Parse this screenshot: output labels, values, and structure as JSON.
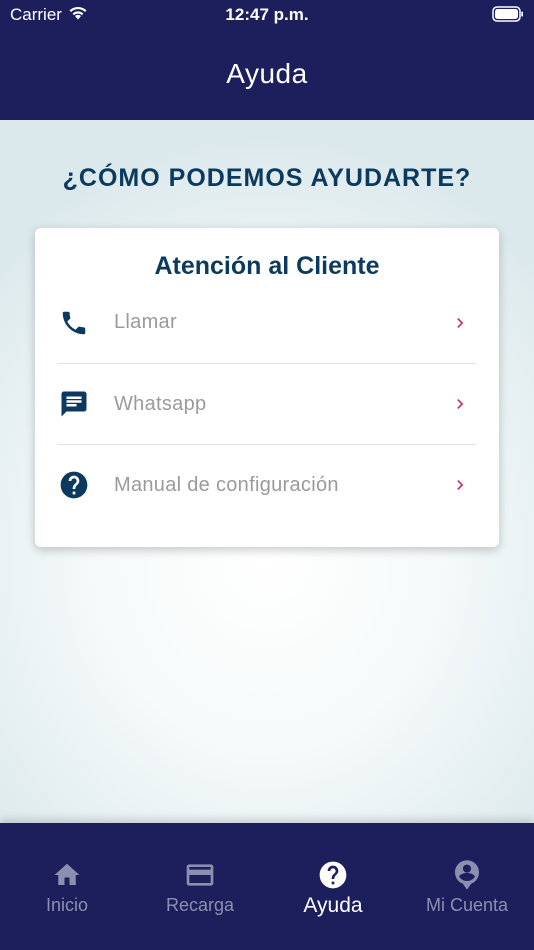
{
  "status_bar": {
    "carrier": "Carrier",
    "time": "12:47 p.m."
  },
  "header": {
    "title": "Ayuda"
  },
  "main": {
    "heading": "¿CÓMO PODEMOS AYUDARTE?",
    "card": {
      "title": "Atención al Cliente",
      "items": [
        {
          "label": "Llamar",
          "icon": "phone-icon"
        },
        {
          "label": "Whatsapp",
          "icon": "chat-icon"
        },
        {
          "label": "Manual de configuración",
          "icon": "help-circle-icon"
        }
      ]
    }
  },
  "tabbar": {
    "tabs": [
      {
        "label": "Inicio",
        "icon": "home-icon",
        "active": false
      },
      {
        "label": "Recarga",
        "icon": "credit-card-icon",
        "active": false
      },
      {
        "label": "Ayuda",
        "icon": "help-circle-icon",
        "active": true
      },
      {
        "label": "Mi Cuenta",
        "icon": "account-icon",
        "active": false
      }
    ]
  },
  "colors": {
    "header_bg": "#1d1f5c",
    "heading_text": "#0c3a5e",
    "chevron_accent": "#c2306e",
    "inactive_tab": "#8d8fb0",
    "active_tab": "#ffffff"
  }
}
